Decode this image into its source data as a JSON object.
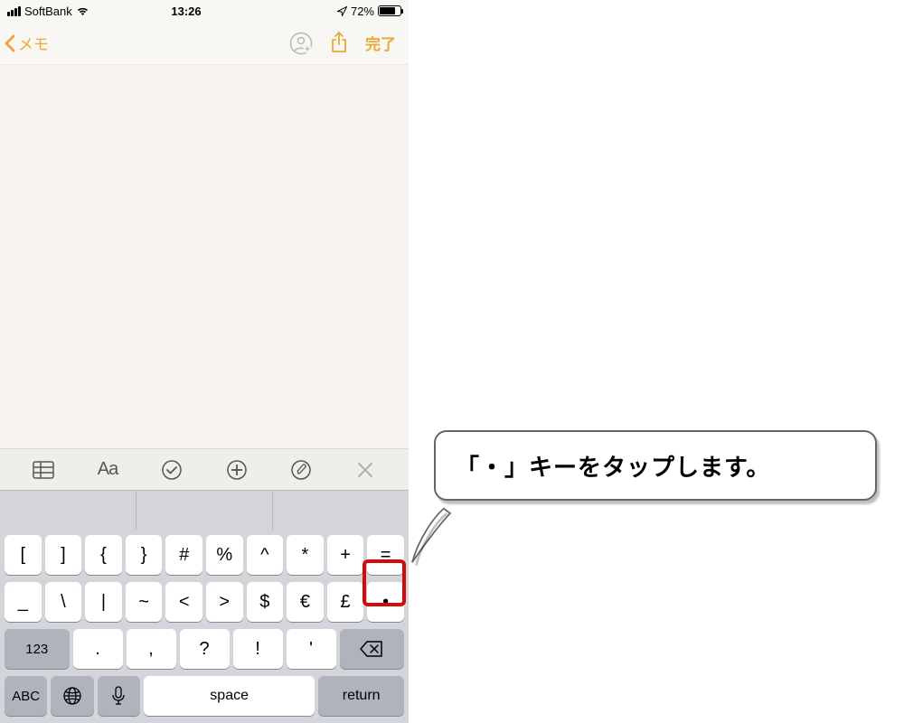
{
  "status": {
    "carrier": "SoftBank",
    "time": "13:26",
    "battery_pct": "72%"
  },
  "nav": {
    "back_label": "メモ",
    "done_label": "完了"
  },
  "format_bar": {
    "aa": "Aa"
  },
  "keyboard": {
    "row1": [
      "[",
      "]",
      "{",
      "}",
      "#",
      "%",
      "^",
      "*",
      "+",
      "="
    ],
    "row2": [
      "_",
      "\\",
      "|",
      "~",
      "<",
      ">",
      "$",
      "€",
      "£",
      "•"
    ],
    "row3": {
      "mode": "123",
      "keys": [
        ".",
        ",",
        "?",
        "!",
        "'"
      ]
    },
    "row4": {
      "abc": "ABC",
      "space": "space",
      "return": "return"
    }
  },
  "callout": {
    "text": "「・」キーをタップします。"
  }
}
